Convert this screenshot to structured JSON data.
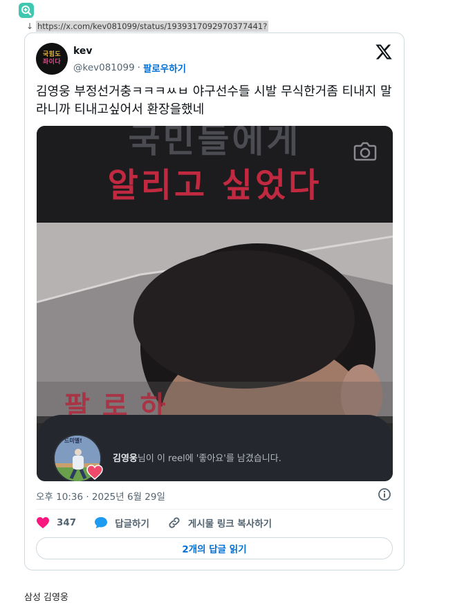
{
  "app": {
    "logo_icon": "search-plus-icon",
    "accent": "#3fc7b0"
  },
  "source": {
    "arrow": "↓",
    "url": "https://x.com/kev081099/status/1939317092970377441?"
  },
  "tweet": {
    "author_name": "kev",
    "avatar_text": [
      "국힘도",
      "좌이다"
    ],
    "handle": "@kev081099",
    "separator": "·",
    "follow_label": "팔로우하기",
    "brand_icon": "x-logo-icon",
    "text": "김영웅 부정선거충ㅋㅋㅋㅆㅂ 야구선수들 시발 무식한거좀 티내지 말라니까 티내고싶어서 환장을했네",
    "media": {
      "caption_line1": "국민들에게",
      "caption_line2": "알리고 싶었다",
      "caption_partial": "팔로하",
      "camera_icon": "camera-icon",
      "like_notice": {
        "user": "김영웅",
        "message": "님이 이 reel에 '좋아요'를 남겼습니다.",
        "avatar_text": "드미엘!"
      }
    },
    "timestamp": "오후 10:36 · 2025년 6월 29일",
    "like_count": "347",
    "reply_label": "답글하기",
    "copy_link_label": "게시물 링크 복사하기",
    "read_replies_label": "2개의 답글 읽기",
    "colors": {
      "link": "#006fd6",
      "like": "#f91880",
      "reply": "#1d9bf0",
      "border": "#cfd9de"
    }
  },
  "footer": {
    "caption": "삼성 김영웅"
  }
}
